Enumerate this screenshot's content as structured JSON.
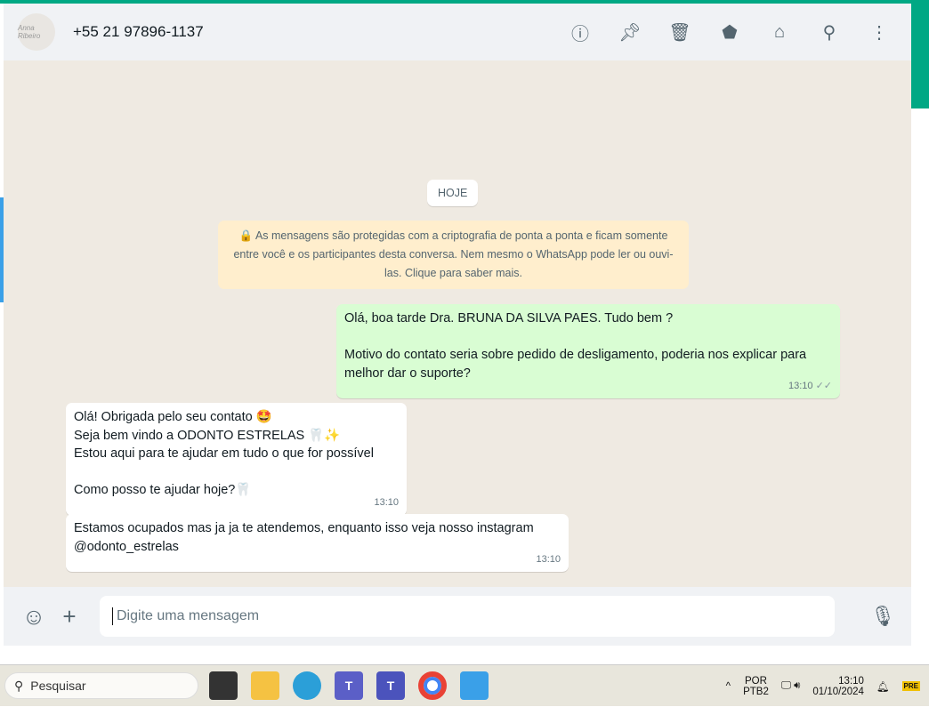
{
  "header": {
    "contact": "+55 21 97896-1137",
    "avatar_text": "Anna Ribeiro"
  },
  "chat": {
    "day": "HOJE",
    "encryption": "🔒 As mensagens são protegidas com a criptografia de ponta a ponta e ficam somente entre você e os participantes desta conversa. Nem mesmo o WhatsApp pode ler ou ouvi-las. Clique para saber mais.",
    "messages": [
      {
        "text": "Olá, boa tarde Dra. BRUNA DA SILVA PAES. Tudo bem ?\n\nMotivo do contato seria sobre pedido de desligamento, poderia nos explicar para melhor dar o suporte?",
        "time": "13:10",
        "ticks": "✓✓"
      },
      {
        "text": "Olá! Obrigada pelo seu contato 🤩\nSeja bem vindo a ODONTO ESTRELAS 🦷✨\nEstou aqui para te ajudar em tudo o que for possível\n\nComo posso te ajudar hoje?🦷",
        "time": "13:10"
      },
      {
        "text": "Estamos ocupados mas ja ja te atendemos, enquanto isso veja nosso instagram @odonto_estrelas",
        "time": "13:10"
      }
    ]
  },
  "composer": {
    "placeholder": "Digite uma mensagem"
  },
  "taskbar": {
    "search": "Pesquisar",
    "lang1": "POR",
    "lang2": "PTB2",
    "time": "13:10",
    "date": "01/10/2024",
    "copilot_badge": "PRE"
  }
}
